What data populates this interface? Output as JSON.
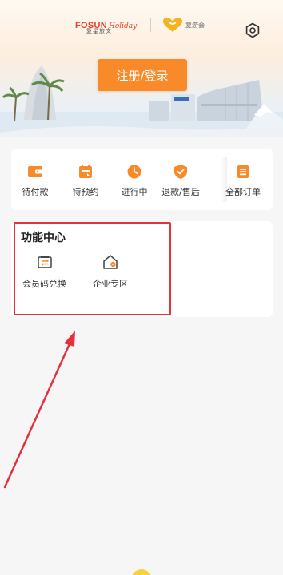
{
  "header": {
    "brand_name": "FOSUN",
    "brand_script": "Holiday",
    "brand_sub": "复星旅文",
    "club_name": "复游会",
    "login_label": "注册/登录"
  },
  "orders": {
    "items": [
      {
        "label": "待付款",
        "icon": "wallet-icon"
      },
      {
        "label": "待预约",
        "icon": "calendar-icon"
      },
      {
        "label": "进行中",
        "icon": "clock-icon"
      },
      {
        "label": "退款/售后",
        "icon": "shield-check-icon"
      },
      {
        "label": "全部订单",
        "icon": "order-list-icon"
      }
    ]
  },
  "functions": {
    "title": "功能中心",
    "items": [
      {
        "label": "会员码兑换",
        "icon": "exchange-ticket-icon"
      },
      {
        "label": "企业专区",
        "icon": "enterprise-house-icon"
      }
    ]
  },
  "colors": {
    "accent_orange": "#f88a2a",
    "annotation_red": "#e2333c",
    "brand_red": "#e8402f"
  }
}
